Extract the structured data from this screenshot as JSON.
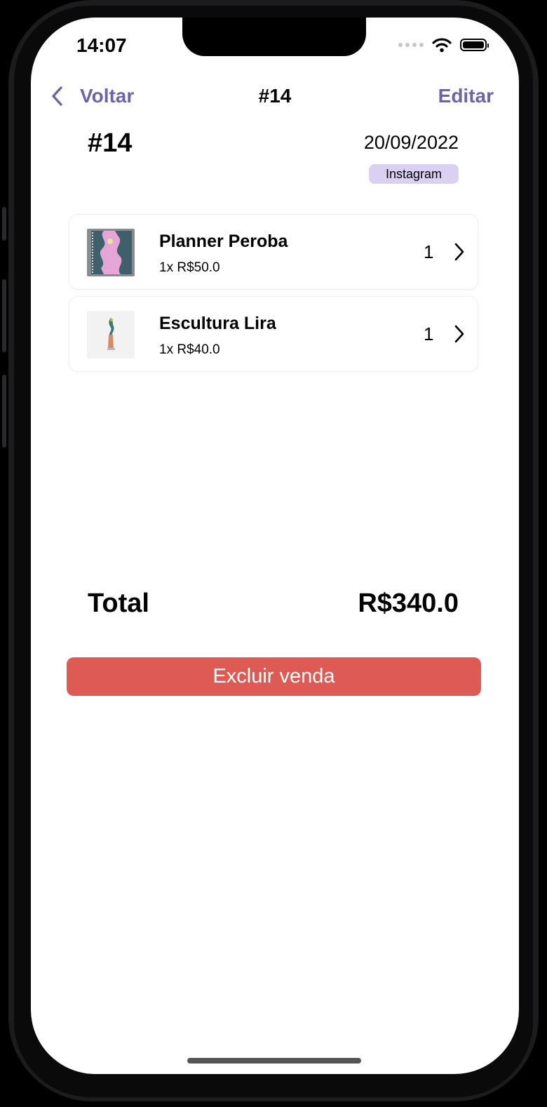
{
  "status_bar": {
    "time": "14:07",
    "icons": [
      "cellular-dots-icon",
      "wifi-icon",
      "battery-icon"
    ]
  },
  "nav": {
    "back_label": "Voltar",
    "title": "#14",
    "edit_label": "Editar",
    "accent_color": "#6b64a8"
  },
  "order": {
    "id": "#14",
    "date": "20/09/2022",
    "channel": "Instagram",
    "channel_color": "#d9d0f2"
  },
  "items": [
    {
      "name": "Planner Peroba",
      "detail": "1x R$50.0",
      "quantity": "1",
      "thumbnail": "planner-image"
    },
    {
      "name": "Escultura Lira",
      "detail": "1x R$40.0",
      "quantity": "1",
      "thumbnail": "sculpture-image"
    }
  ],
  "summary": {
    "total_label": "Total",
    "total_value": "R$340.0"
  },
  "actions": {
    "delete_label": "Excluir venda",
    "delete_color": "#de5a55"
  }
}
